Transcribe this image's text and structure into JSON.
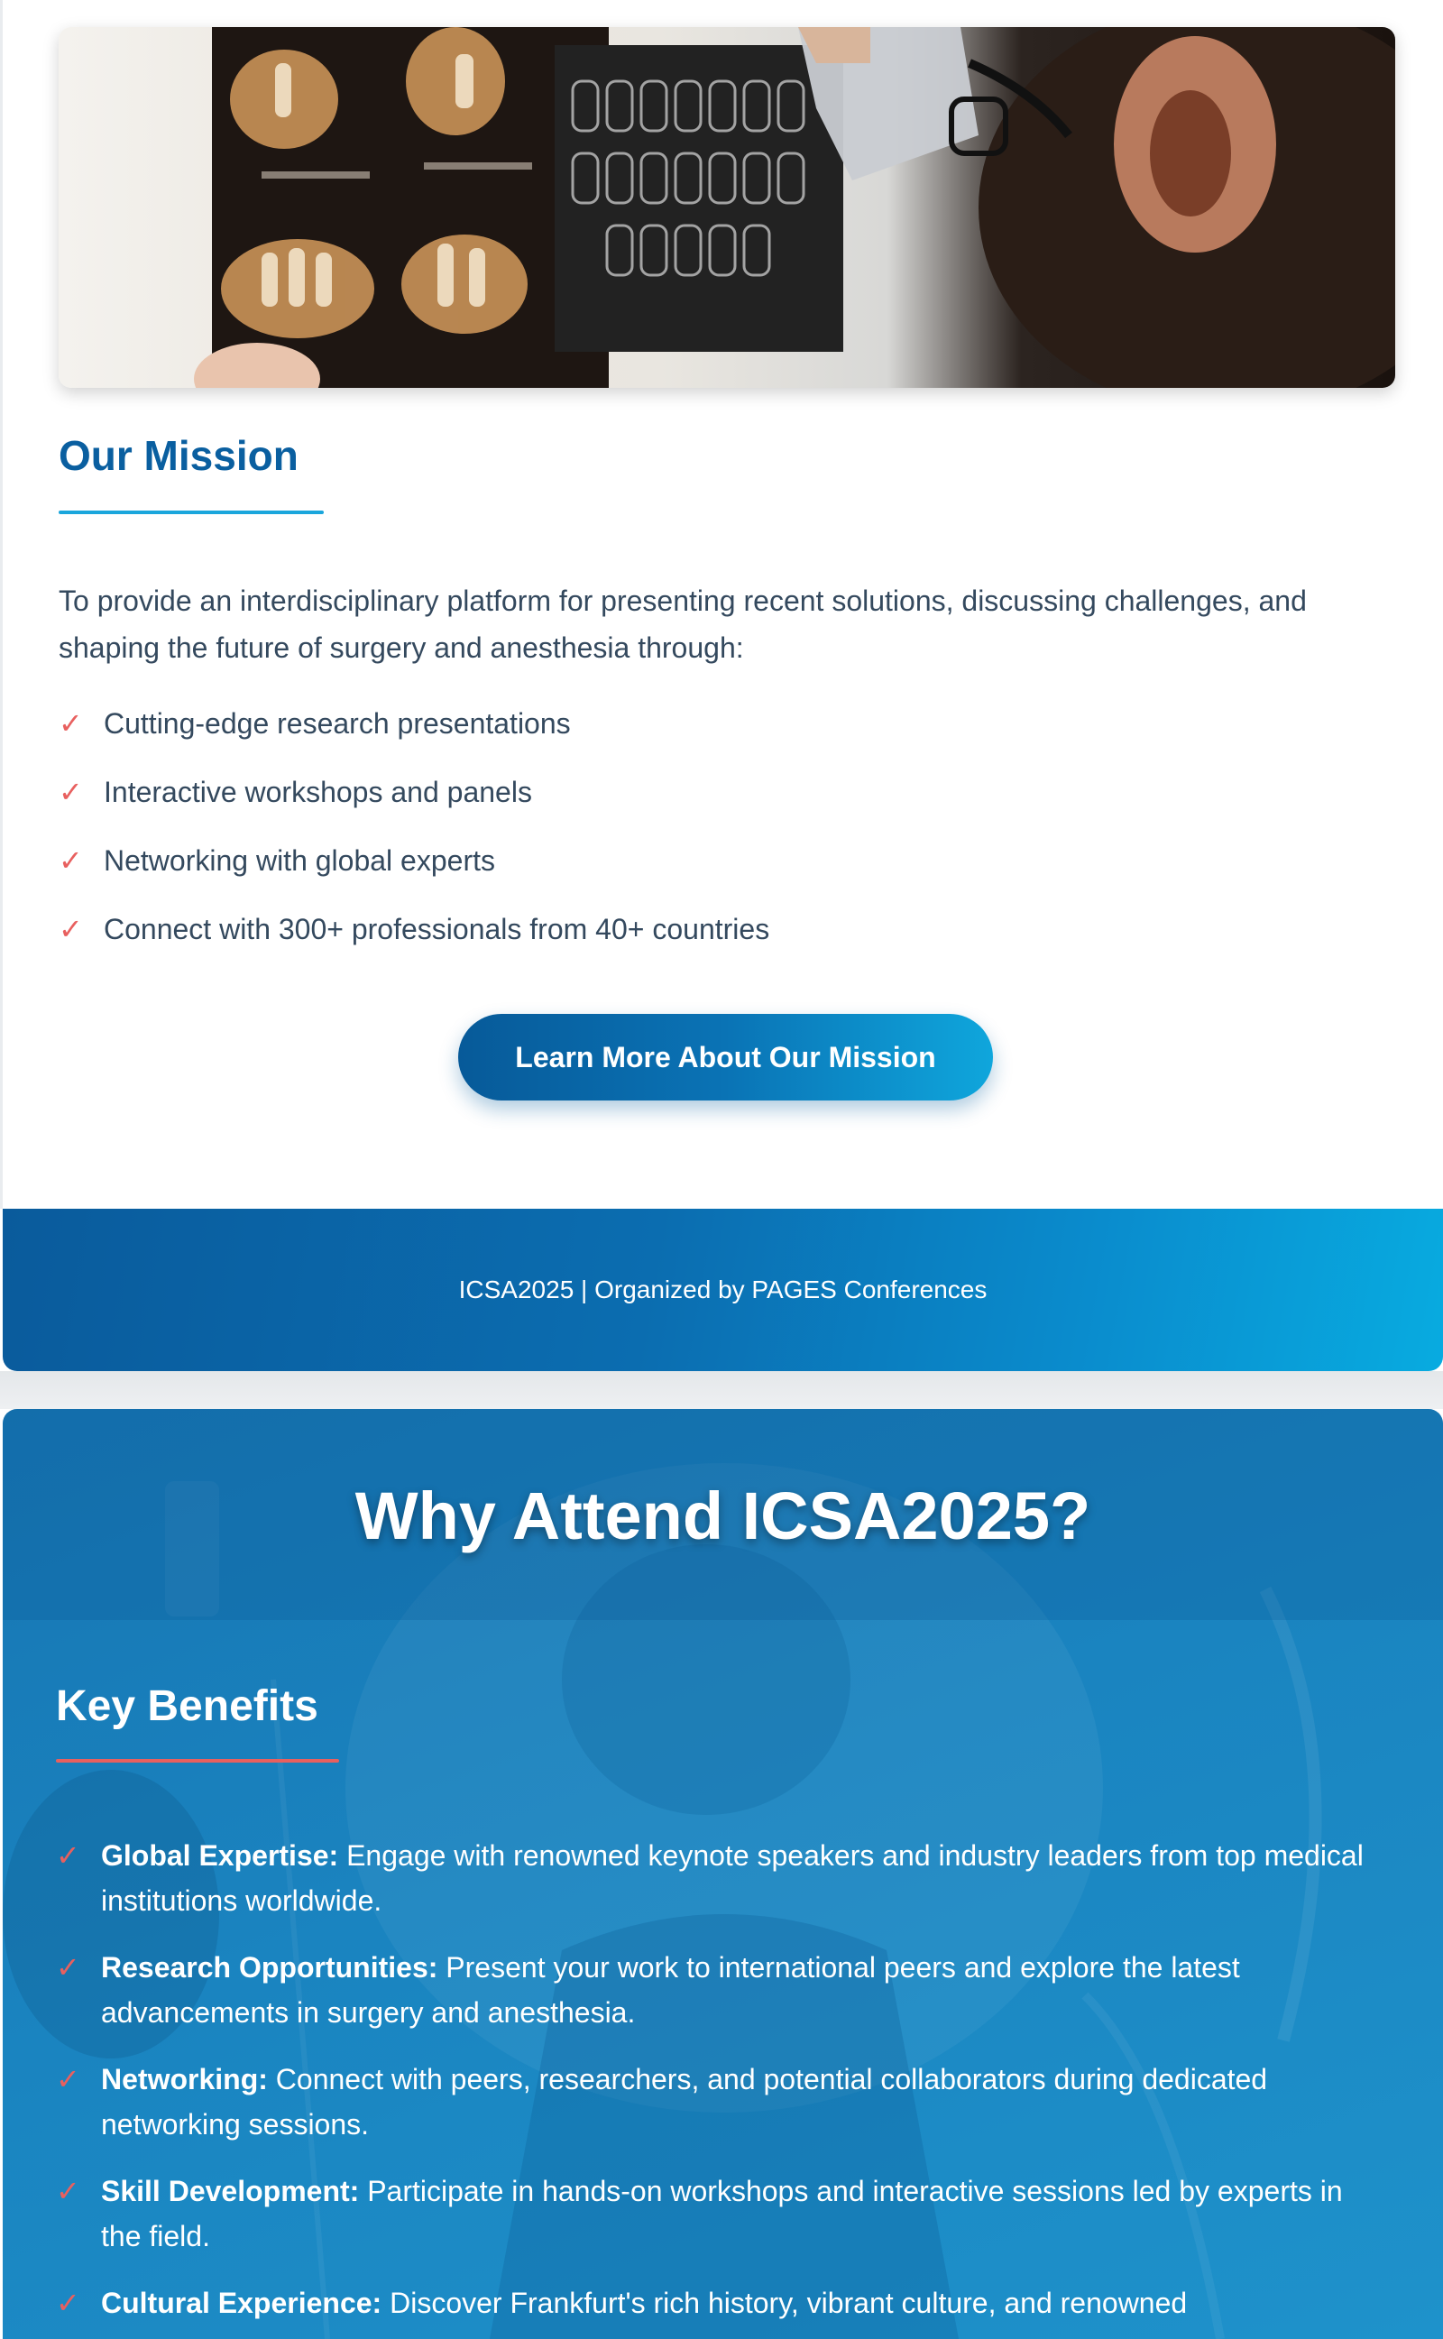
{
  "mission": {
    "title": "Our Mission",
    "intro": "To provide an interdisciplinary platform for presenting recent solutions, discussing challenges, and shaping the future of surgery and anesthesia through:",
    "items": [
      "Cutting-edge research presentations",
      "Interactive workshops and panels",
      "Networking with global experts",
      "Connect with 300+ professionals from 40+ countries"
    ],
    "button_label": "Learn More About Our Mission",
    "check_glyph": "✓"
  },
  "footer": {
    "text": "ICSA2025 | Organized by PAGES Conferences"
  },
  "why_attend": {
    "title": "Why Attend ICSA2025?",
    "benefits_title": "Key Benefits",
    "benefits": [
      {
        "label": "Global Expertise:",
        "text": " Engage with renowned keynote speakers and industry leaders from top medical institutions worldwide."
      },
      {
        "label": "Research Opportunities:",
        "text": " Present your work to international peers and explore the latest advancements in surgery and anesthesia."
      },
      {
        "label": "Networking:",
        "text": " Connect with peers, researchers, and potential collaborators during dedicated networking sessions."
      },
      {
        "label": "Skill Development:",
        "text": " Participate in hands-on workshops and interactive sessions led by experts in the field."
      },
      {
        "label": "Cultural Experience:",
        "text": " Discover Frankfurt's rich history, vibrant culture, and renowned"
      }
    ]
  },
  "colors": {
    "primary": "#0a5fa0",
    "accent_blue": "#1aa6dc",
    "accent_red": "#e8605f"
  },
  "icons": {
    "check": "check-icon",
    "hero": "dental-xray-photo"
  }
}
